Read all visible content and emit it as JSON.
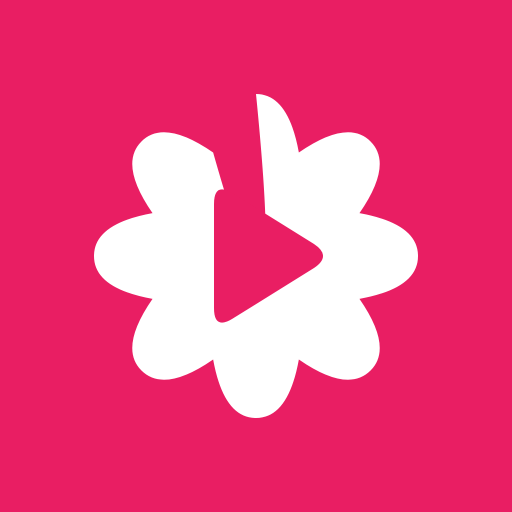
{
  "colors": {
    "background": "#E91E63",
    "badge": "#FFFFFF",
    "play": "#E91E63"
  },
  "icon": {
    "badge": "flower-badge-icon",
    "play": "play-icon"
  }
}
